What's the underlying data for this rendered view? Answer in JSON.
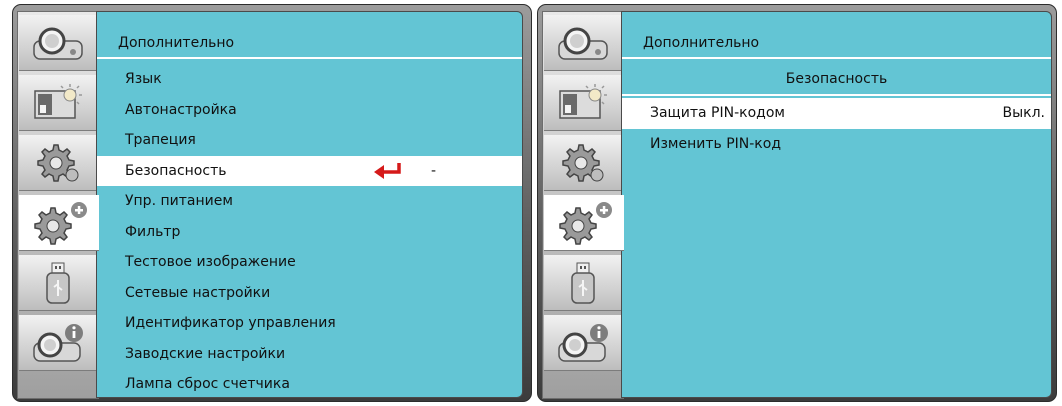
{
  "left_panel": {
    "sidebar": {
      "tabs": [
        {
          "icon": "projector-icon",
          "selected": false
        },
        {
          "icon": "picture-brightness-icon",
          "selected": false
        },
        {
          "icon": "gear-icon",
          "selected": false
        },
        {
          "icon": "gear-plus-icon",
          "selected": true
        },
        {
          "icon": "usb-drive-icon",
          "selected": false
        },
        {
          "icon": "projector-info-icon",
          "selected": false
        }
      ]
    },
    "title": "Дополнительно",
    "items": [
      {
        "label": "Язык"
      },
      {
        "label": "Автонастройка"
      },
      {
        "label": "Трапеция"
      },
      {
        "label": "Безопасность",
        "selected": true,
        "enter_icon": "enter-arrow-icon",
        "mark": "-"
      },
      {
        "label": "Упр. питанием"
      },
      {
        "label": "Фильтр"
      },
      {
        "label": "Тестовое изображение"
      },
      {
        "label": "Сетевые настройки"
      },
      {
        "label": "Идентификатор управления"
      },
      {
        "label": "Заводские настройки"
      },
      {
        "label": "Лампа сброс счетчика"
      }
    ]
  },
  "right_panel": {
    "title": "Дополнительно",
    "subtitle": "Безопасность",
    "items": [
      {
        "label": "Защита PIN-кодом",
        "value": "Выкл.",
        "selected": true
      },
      {
        "label": "Изменить PIN-код"
      }
    ]
  },
  "colors": {
    "content_bg": "#63c5d4",
    "selection_bg": "#ffffff",
    "frame": "#5f5f5f",
    "enter_arrow": "#d51a1a"
  }
}
